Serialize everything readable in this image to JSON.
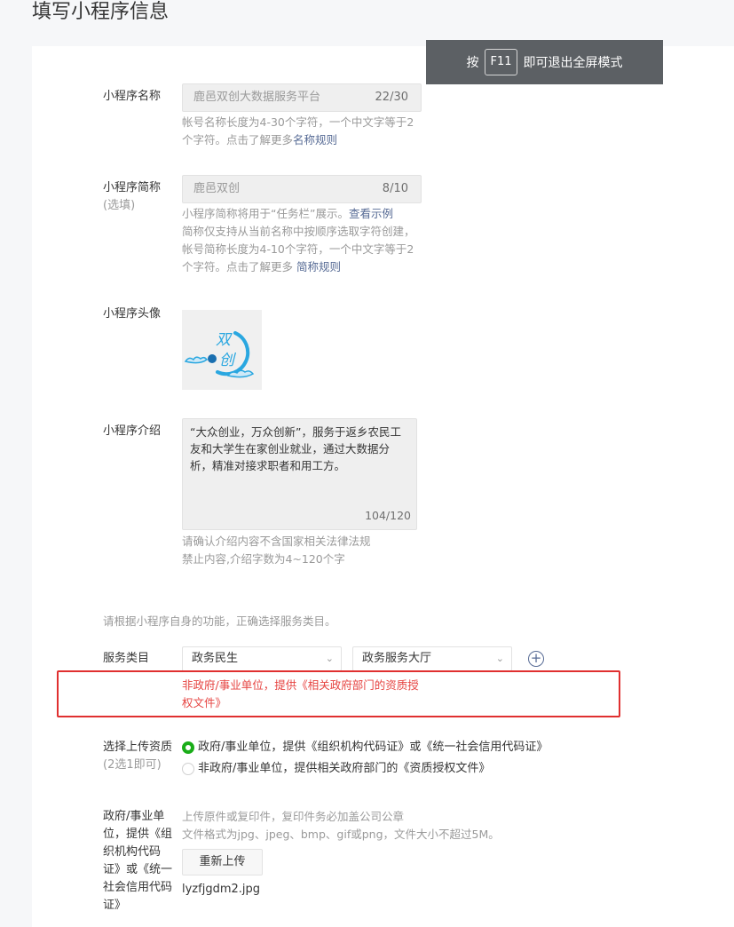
{
  "page": {
    "title": "填写小程序信息"
  },
  "toast": {
    "prefix": "按",
    "key": "F11",
    "suffix": "即可退出全屏模式"
  },
  "name": {
    "label": "小程序名称",
    "value": "鹿邑双创大数据服务平台",
    "count": "22/30",
    "tip_line1": "帐号名称长度为4-30个字符，一个中文字等于2",
    "tip_line2": "个字符。点击了解更多",
    "tip_link": "名称规则"
  },
  "short_name": {
    "label": "小程序简称",
    "label_sub": "(选填)",
    "value": "鹿邑双创",
    "count": "8/10",
    "tip_line1": "小程序简称将用于“任务栏”展示。",
    "tip_link1": "查看示例",
    "tip_line2": "简称仅支持从当前名称中按顺序选取字符创建，",
    "tip_line3": "帐号简称长度为4-10个字符，一个中文字等于2",
    "tip_line4": "个字符。点击了解更多 ",
    "tip_link2": "简称规则"
  },
  "avatar": {
    "label": "小程序头像",
    "logo_text": "双创"
  },
  "intro": {
    "label": "小程序介绍",
    "value": "“大众创业，万众创新”，服务于返乡农民工友和大学生在家创业就业，通过大数据分析，精准对接求职者和用工方。",
    "count": "104/120",
    "tip_line1": "请确认介绍内容不含国家相关法律法规",
    "tip_line2": "禁止内容,介绍字数为4~120个字"
  },
  "category": {
    "hint": "请根据小程序自身的功能，正确选择服务类目。",
    "label": "服务类目",
    "select1": "政务民生",
    "select2": "政务服务大厅",
    "error_line1": "非政府/事业单位，提供《相关政府部门的资质授",
    "error_line2": "权文件》"
  },
  "qualification": {
    "label": "选择上传资质",
    "label_sub": "(2选1即可)",
    "option1": "政府/事业单位，提供《组织机构代码证》或《统一社会信用代码证》",
    "option2": "非政府/事业单位，提供相关政府部门的《资质授权文件》"
  },
  "upload": {
    "label_lines": [
      "政府/事业单",
      "位，提供《组",
      "织机构代码",
      "证》或《统一",
      "社会信用代码",
      "证》"
    ],
    "tip_line1": "上传原件或复印件，复印件务必加盖公司公章",
    "tip_line2": "文件格式为jpg、jpeg、bmp、gif或png，文件大小不超过5M。",
    "button": "重新上传",
    "filename": "lyzfjgdm2.jpg"
  },
  "colors": {
    "accent": "#1aad19",
    "link": "#576b95",
    "error": "#e64340",
    "highlight_box": "#e03030"
  }
}
